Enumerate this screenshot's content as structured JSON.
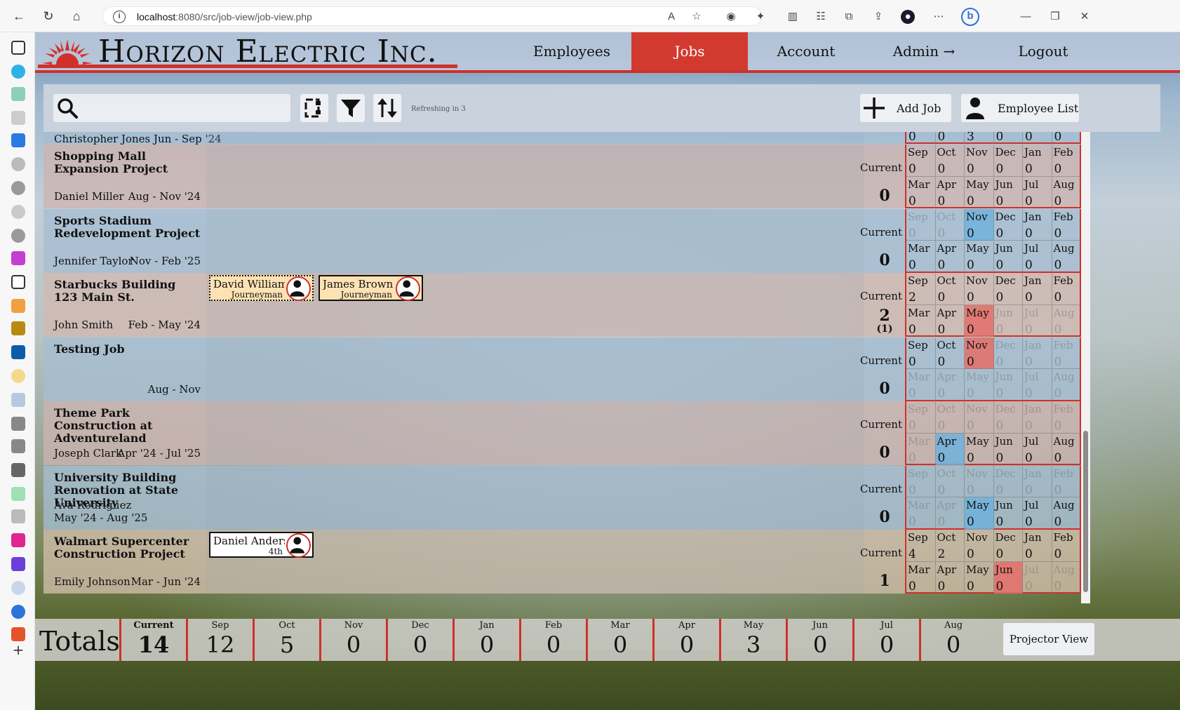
{
  "browser": {
    "url_host": "localhost",
    "url_rest": ":8080/src/job-view/job-view.php"
  },
  "logo": {
    "text": "Horizon Electric Inc."
  },
  "nav": {
    "employees": "Employees",
    "jobs": "Jobs",
    "account": "Account",
    "admin": "Admin →",
    "logout": "Logout"
  },
  "toolbar": {
    "refresh_text": "Refreshing in 3",
    "add_job": "Add Job",
    "employee_list": "Employee List"
  },
  "current_label": "Current",
  "top_partial": {
    "text": "Christopher Jones Jun - Sep '24",
    "months": [
      "0",
      "0",
      "3",
      "0",
      "0",
      "0"
    ]
  },
  "jobs": [
    {
      "name": "Shopping Mall Expansion Project",
      "lead": "Daniel Miller",
      "dates": "Aug - Nov '24",
      "current": "0",
      "current_sub": "",
      "bg": "rgba(205,180,175,0.78)",
      "employees": [],
      "months": [
        {
          "m": "Sep",
          "v": "0",
          "s": ""
        },
        {
          "m": "Oct",
          "v": "0",
          "s": ""
        },
        {
          "m": "Nov",
          "v": "0",
          "s": ""
        },
        {
          "m": "Dec",
          "v": "0",
          "s": ""
        },
        {
          "m": "Jan",
          "v": "0",
          "s": ""
        },
        {
          "m": "Feb",
          "v": "0",
          "s": ""
        },
        {
          "m": "Mar",
          "v": "0",
          "s": ""
        },
        {
          "m": "Apr",
          "v": "0",
          "s": ""
        },
        {
          "m": "May",
          "v": "0",
          "s": ""
        },
        {
          "m": "Jun",
          "v": "0",
          "s": ""
        },
        {
          "m": "Jul",
          "v": "0",
          "s": ""
        },
        {
          "m": "Aug",
          "v": "0",
          "s": ""
        }
      ]
    },
    {
      "name": "Sports Stadium Redevelopment Project",
      "lead": "Jennifer Taylor",
      "dates": "Nov - Feb '25",
      "current": "0",
      "current_sub": "",
      "bg": "rgba(165,190,210,0.78)",
      "employees": [],
      "months": [
        {
          "m": "Sep",
          "v": "0",
          "s": "dim"
        },
        {
          "m": "Oct",
          "v": "0",
          "s": "dim"
        },
        {
          "m": "Nov",
          "v": "0",
          "s": "blue"
        },
        {
          "m": "Dec",
          "v": "0",
          "s": ""
        },
        {
          "m": "Jan",
          "v": "0",
          "s": ""
        },
        {
          "m": "Feb",
          "v": "0",
          "s": ""
        },
        {
          "m": "Mar",
          "v": "0",
          "s": ""
        },
        {
          "m": "Apr",
          "v": "0",
          "s": ""
        },
        {
          "m": "May",
          "v": "0",
          "s": ""
        },
        {
          "m": "Jun",
          "v": "0",
          "s": ""
        },
        {
          "m": "Jul",
          "v": "0",
          "s": ""
        },
        {
          "m": "Aug",
          "v": "0",
          "s": ""
        }
      ]
    },
    {
      "name": "Starbucks Building 123 Main St.",
      "lead": "John Smith",
      "dates": "Feb - May '24",
      "current": "2",
      "current_sub": "(1)",
      "bg": "rgba(210,185,175,0.78)",
      "employees": [
        {
          "name": "David Williams",
          "role": "Journeyman",
          "style": "dotted",
          "bg": "#fde3b3"
        },
        {
          "name": "James Brown",
          "role": "Journeyman",
          "style": "solid",
          "bg": "#fde3b3"
        }
      ],
      "months": [
        {
          "m": "Sep",
          "v": "2",
          "s": ""
        },
        {
          "m": "Oct",
          "v": "0",
          "s": ""
        },
        {
          "m": "Nov",
          "v": "0",
          "s": ""
        },
        {
          "m": "Dec",
          "v": "0",
          "s": ""
        },
        {
          "m": "Jan",
          "v": "0",
          "s": ""
        },
        {
          "m": "Feb",
          "v": "0",
          "s": ""
        },
        {
          "m": "Mar",
          "v": "0",
          "s": ""
        },
        {
          "m": "Apr",
          "v": "0",
          "s": ""
        },
        {
          "m": "May",
          "v": "0",
          "s": "red"
        },
        {
          "m": "Jun",
          "v": "0",
          "s": "dim"
        },
        {
          "m": "Jul",
          "v": "0",
          "s": "dim"
        },
        {
          "m": "Aug",
          "v": "0",
          "s": "dim"
        }
      ]
    },
    {
      "name": "Testing Job",
      "lead": "",
      "dates": "Aug - Nov",
      "current": "0",
      "current_sub": "",
      "bg": "rgba(165,190,210,0.78)",
      "employees": [],
      "months": [
        {
          "m": "Sep",
          "v": "0",
          "s": ""
        },
        {
          "m": "Oct",
          "v": "0",
          "s": ""
        },
        {
          "m": "Nov",
          "v": "0",
          "s": "red"
        },
        {
          "m": "Dec",
          "v": "0",
          "s": "dim"
        },
        {
          "m": "Jan",
          "v": "0",
          "s": "dim"
        },
        {
          "m": "Feb",
          "v": "0",
          "s": "dim"
        },
        {
          "m": "Mar",
          "v": "0",
          "s": "dim"
        },
        {
          "m": "Apr",
          "v": "0",
          "s": "dim"
        },
        {
          "m": "May",
          "v": "0",
          "s": "dim"
        },
        {
          "m": "Jun",
          "v": "0",
          "s": "dim"
        },
        {
          "m": "Jul",
          "v": "0",
          "s": "dim"
        },
        {
          "m": "Aug",
          "v": "0",
          "s": "dim"
        }
      ]
    },
    {
      "name": "Theme Park Construction at Adventureland",
      "lead": "Joseph Clark",
      "dates": "Apr '24 - Jul '25",
      "current": "0",
      "current_sub": "",
      "bg": "rgba(205,180,175,0.78)",
      "employees": [],
      "months": [
        {
          "m": "Sep",
          "v": "0",
          "s": "dim"
        },
        {
          "m": "Oct",
          "v": "0",
          "s": "dim"
        },
        {
          "m": "Nov",
          "v": "0",
          "s": "dim"
        },
        {
          "m": "Dec",
          "v": "0",
          "s": "dim"
        },
        {
          "m": "Jan",
          "v": "0",
          "s": "dim"
        },
        {
          "m": "Feb",
          "v": "0",
          "s": "dim"
        },
        {
          "m": "Mar",
          "v": "0",
          "s": "dim"
        },
        {
          "m": "Apr",
          "v": "0",
          "s": "blue"
        },
        {
          "m": "May",
          "v": "0",
          "s": ""
        },
        {
          "m": "Jun",
          "v": "0",
          "s": ""
        },
        {
          "m": "Jul",
          "v": "0",
          "s": ""
        },
        {
          "m": "Aug",
          "v": "0",
          "s": ""
        }
      ]
    },
    {
      "name": "University Building Renovation at State University",
      "lead": "Ava Rodriguez",
      "dates": "May '24 - Aug '25",
      "current": "0",
      "current_sub": "",
      "bg": "rgba(165,190,210,0.78)",
      "employees": [],
      "months": [
        {
          "m": "Sep",
          "v": "0",
          "s": "dim"
        },
        {
          "m": "Oct",
          "v": "0",
          "s": "dim"
        },
        {
          "m": "Nov",
          "v": "0",
          "s": "dim"
        },
        {
          "m": "Dec",
          "v": "0",
          "s": "dim"
        },
        {
          "m": "Jan",
          "v": "0",
          "s": "dim"
        },
        {
          "m": "Feb",
          "v": "0",
          "s": "dim"
        },
        {
          "m": "Mar",
          "v": "0",
          "s": "dim"
        },
        {
          "m": "Apr",
          "v": "0",
          "s": "dim"
        },
        {
          "m": "May",
          "v": "0",
          "s": "blue"
        },
        {
          "m": "Jun",
          "v": "0",
          "s": ""
        },
        {
          "m": "Jul",
          "v": "0",
          "s": ""
        },
        {
          "m": "Aug",
          "v": "0",
          "s": ""
        }
      ]
    },
    {
      "name": "Walmart Supercenter Construction Project",
      "lead": "Emily Johnson",
      "dates": "Mar - Jun '24",
      "current": "1",
      "current_sub": "",
      "bg": "rgba(210,190,170,0.78)",
      "employees": [
        {
          "name": "Daniel Anderson",
          "role": "4th",
          "style": "solid",
          "bg": "#ffffff"
        }
      ],
      "months": [
        {
          "m": "Sep",
          "v": "4",
          "s": ""
        },
        {
          "m": "Oct",
          "v": "2",
          "s": ""
        },
        {
          "m": "Nov",
          "v": "0",
          "s": ""
        },
        {
          "m": "Dec",
          "v": "0",
          "s": ""
        },
        {
          "m": "Jan",
          "v": "0",
          "s": ""
        },
        {
          "m": "Feb",
          "v": "0",
          "s": ""
        },
        {
          "m": "Mar",
          "v": "0",
          "s": ""
        },
        {
          "m": "Apr",
          "v": "0",
          "s": ""
        },
        {
          "m": "May",
          "v": "0",
          "s": ""
        },
        {
          "m": "Jun",
          "v": "0",
          "s": "red"
        },
        {
          "m": "Jul",
          "v": "0",
          "s": "dim"
        },
        {
          "m": "Aug",
          "v": "0",
          "s": "dim"
        }
      ]
    }
  ],
  "totals": {
    "title": "Totals",
    "cells": [
      {
        "label": "Current",
        "value": "14"
      },
      {
        "label": "Sep",
        "value": "12"
      },
      {
        "label": "Oct",
        "value": "5"
      },
      {
        "label": "Nov",
        "value": "0"
      },
      {
        "label": "Dec",
        "value": "0"
      },
      {
        "label": "Jan",
        "value": "0"
      },
      {
        "label": "Feb",
        "value": "0"
      },
      {
        "label": "Mar",
        "value": "0"
      },
      {
        "label": "Apr",
        "value": "0"
      },
      {
        "label": "May",
        "value": "3"
      },
      {
        "label": "Jun",
        "value": "0"
      },
      {
        "label": "Jul",
        "value": "0"
      },
      {
        "label": "Aug",
        "value": "0"
      }
    ],
    "projector": "Projector View"
  },
  "colors": {
    "accent_red": "#d0302a",
    "nav_active": "#d33a2f",
    "month_blue": "#6eb2dc",
    "month_red": "#e46e69"
  }
}
